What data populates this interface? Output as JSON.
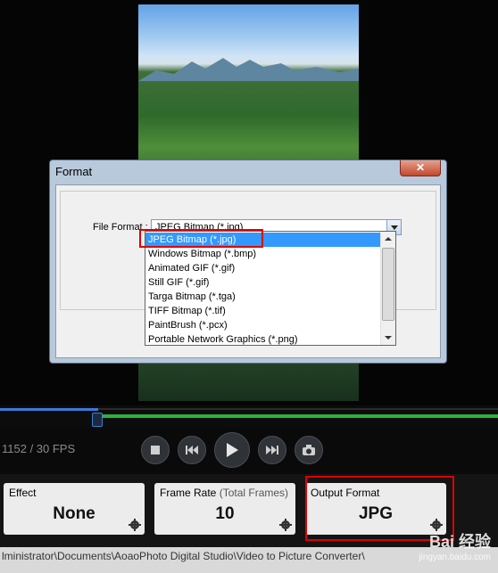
{
  "player": {
    "frame_info": "1152 / 30 FPS",
    "progress": 0.2
  },
  "dialog": {
    "title": "Format",
    "close_symbol": "✕",
    "file_format_label": "File Format :",
    "selected_format": "JPEG Bitmap (*.jpg)",
    "options": [
      "JPEG Bitmap (*.jpg)",
      "Windows Bitmap (*.bmp)",
      "Animated GIF (*.gif)",
      "Still GIF (*.gif)",
      "Targa Bitmap (*.tga)",
      "TIFF Bitmap (*.tif)",
      "PaintBrush (*.pcx)",
      "Portable Network Graphics (*.png)"
    ]
  },
  "cards": {
    "effect": {
      "title": "Effect",
      "value": "None"
    },
    "frame_rate": {
      "title": "Frame Rate",
      "title_sub": "(Total Frames)",
      "value": "10"
    },
    "output_format": {
      "title": "Output Format",
      "value": "JPG"
    }
  },
  "path_bar": "lministrator\\Documents\\AoaoPhoto Digital Studio\\Video to Picture Converter\\",
  "watermark": {
    "line1": "Bai 经验",
    "line2": "jingyan.baidu.com"
  },
  "colors": {
    "accent_blue": "#3399ff",
    "highlight_red": "#e00000",
    "timeline_green": "#2cb33a"
  }
}
